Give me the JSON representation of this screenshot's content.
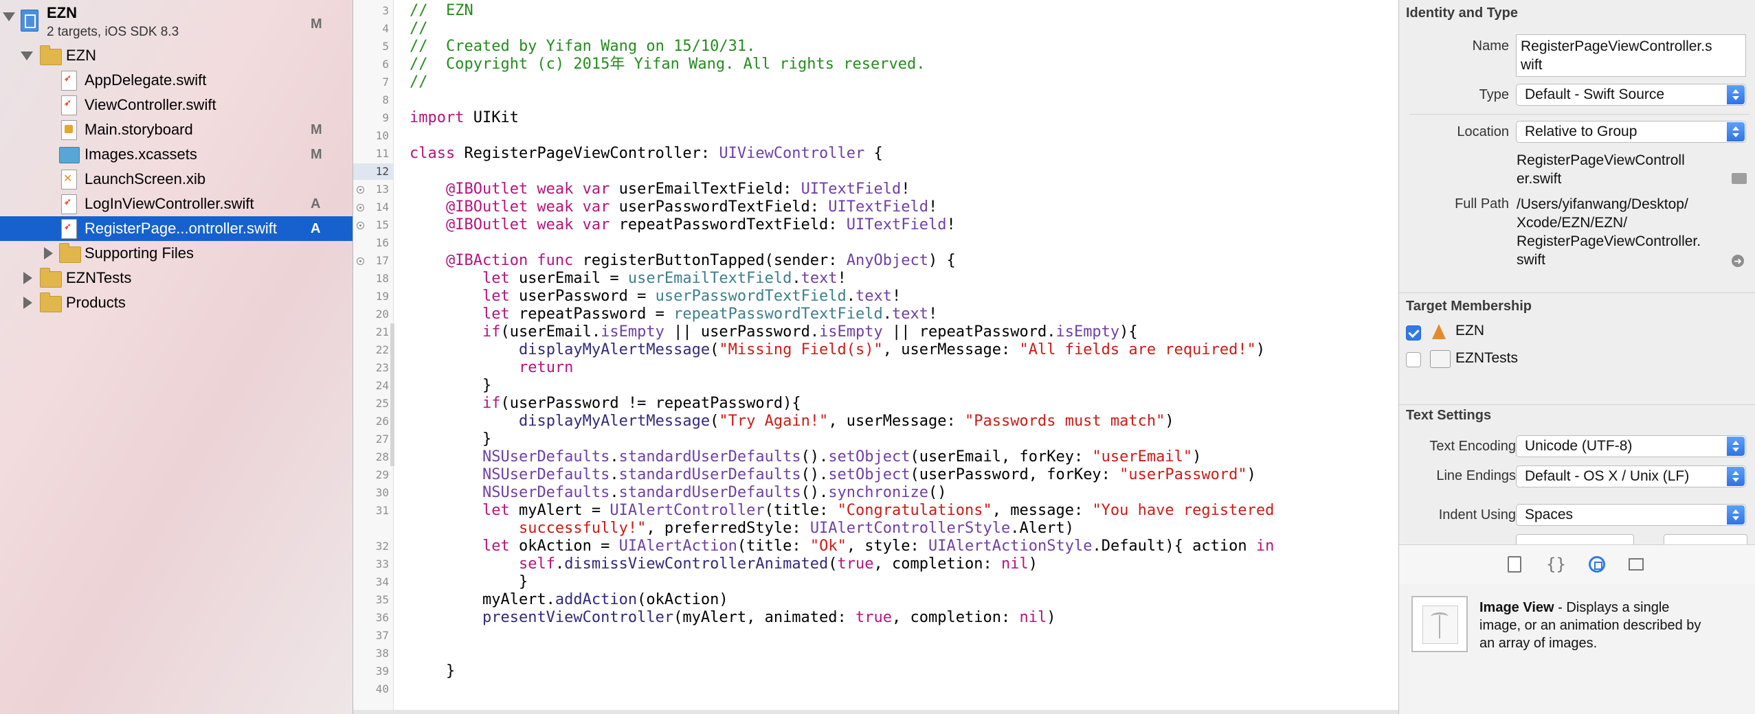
{
  "navigator": {
    "project": {
      "name": "EZN",
      "subtitle": "2 targets, iOS SDK 8.3",
      "badge": "M"
    },
    "items": [
      {
        "label": "EZN",
        "kind": "folder",
        "badge": "",
        "icon": "folder-icon"
      },
      {
        "label": "AppDelegate.swift",
        "kind": "swift",
        "badge": "",
        "icon": "swift-file-icon"
      },
      {
        "label": "ViewController.swift",
        "kind": "swift",
        "badge": "",
        "icon": "swift-file-icon"
      },
      {
        "label": "Main.storyboard",
        "kind": "storyboard",
        "badge": "M",
        "icon": "storyboard-file-icon"
      },
      {
        "label": "Images.xcassets",
        "kind": "assets",
        "badge": "M",
        "icon": "asset-catalog-icon"
      },
      {
        "label": "LaunchScreen.xib",
        "kind": "xib",
        "badge": "",
        "icon": "xib-file-icon"
      },
      {
        "label": "LogInViewController.swift",
        "kind": "swift",
        "badge": "A",
        "icon": "swift-file-icon"
      },
      {
        "label": "RegisterPage...ontroller.swift",
        "kind": "swift",
        "badge": "A",
        "icon": "swift-file-icon"
      },
      {
        "label": "Supporting Files",
        "kind": "folder",
        "badge": "",
        "icon": "folder-icon"
      },
      {
        "label": "EZNTests",
        "kind": "folder",
        "badge": "",
        "icon": "folder-icon"
      },
      {
        "label": "Products",
        "kind": "folder",
        "badge": "",
        "icon": "folder-icon"
      }
    ]
  },
  "editor": {
    "current_line": "12",
    "lines": [
      {
        "n": "3",
        "t": [
          [
            "c-com",
            "//  EZN"
          ]
        ]
      },
      {
        "n": "4",
        "t": [
          [
            "c-com",
            "//"
          ]
        ]
      },
      {
        "n": "5",
        "t": [
          [
            "c-com",
            "//  Created by Yifan Wang on 15/10/31."
          ]
        ]
      },
      {
        "n": "6",
        "t": [
          [
            "c-com",
            "//  Copyright (c) 2015年 Yifan Wang. All rights reserved."
          ]
        ]
      },
      {
        "n": "7",
        "t": [
          [
            "c-com",
            "//"
          ]
        ]
      },
      {
        "n": "8",
        "t": []
      },
      {
        "n": "9",
        "t": [
          [
            "c-kw",
            "import"
          ],
          [
            "",
            " UIKit"
          ]
        ]
      },
      {
        "n": "10",
        "t": []
      },
      {
        "n": "11",
        "t": [
          [
            "c-kw",
            "class"
          ],
          [
            "",
            " RegisterPageViewController: "
          ],
          [
            "c-typ",
            "UIViewController"
          ],
          [
            "",
            " {"
          ]
        ]
      },
      {
        "n": "12",
        "t": []
      },
      {
        "n": "13",
        "t": [
          [
            "",
            "    "
          ],
          [
            "c-kw",
            "@IBOutlet weak var"
          ],
          [
            "",
            " userEmailTextField: "
          ],
          [
            "c-typ",
            "UITextField"
          ],
          [
            "",
            "!"
          ]
        ]
      },
      {
        "n": "14",
        "t": [
          [
            "",
            "    "
          ],
          [
            "c-kw",
            "@IBOutlet weak var"
          ],
          [
            "",
            " userPasswordTextField: "
          ],
          [
            "c-typ",
            "UITextField"
          ],
          [
            "",
            "!"
          ]
        ]
      },
      {
        "n": "15",
        "t": [
          [
            "",
            "    "
          ],
          [
            "c-kw",
            "@IBOutlet weak var"
          ],
          [
            "",
            " repeatPasswordTextField: "
          ],
          [
            "c-typ",
            "UITextField"
          ],
          [
            "",
            "!"
          ]
        ]
      },
      {
        "n": "16",
        "t": []
      },
      {
        "n": "17",
        "t": [
          [
            "",
            "    "
          ],
          [
            "c-kw",
            "@IBAction func"
          ],
          [
            "",
            " registerButtonTapped(sender: "
          ],
          [
            "c-typ",
            "AnyObject"
          ],
          [
            "",
            ") {"
          ]
        ]
      },
      {
        "n": "18",
        "t": [
          [
            "",
            "        "
          ],
          [
            "c-kw",
            "let"
          ],
          [
            "",
            " userEmail = "
          ],
          [
            "c-pr",
            "userEmailTextField"
          ],
          [
            "",
            "."
          ],
          [
            "c-typ",
            "text"
          ],
          [
            "",
            "!"
          ]
        ]
      },
      {
        "n": "19",
        "t": [
          [
            "",
            "        "
          ],
          [
            "c-kw",
            "let"
          ],
          [
            "",
            " userPassword = "
          ],
          [
            "c-pr",
            "userPasswordTextField"
          ],
          [
            "",
            "."
          ],
          [
            "c-typ",
            "text"
          ],
          [
            "",
            "!"
          ]
        ]
      },
      {
        "n": "20",
        "t": [
          [
            "",
            "        "
          ],
          [
            "c-kw",
            "let"
          ],
          [
            "",
            " repeatPassword = "
          ],
          [
            "c-pr",
            "repeatPasswordTextField"
          ],
          [
            "",
            "."
          ],
          [
            "c-typ",
            "text"
          ],
          [
            "",
            "!"
          ]
        ]
      },
      {
        "n": "21",
        "t": [
          [
            "",
            "        "
          ],
          [
            "c-kw",
            "if"
          ],
          [
            "",
            "(userEmail."
          ],
          [
            "c-typ",
            "isEmpty"
          ],
          [
            "",
            " || userPassword."
          ],
          [
            "c-typ",
            "isEmpty"
          ],
          [
            "",
            " || repeatPassword."
          ],
          [
            "c-typ",
            "isEmpty"
          ],
          [
            "",
            "){"
          ]
        ]
      },
      {
        "n": "22",
        "t": [
          [
            "",
            "            "
          ],
          [
            "c-mt",
            "displayMyAlertMessage"
          ],
          [
            "",
            "("
          ],
          [
            "c-str",
            "\"Missing Field(s)\""
          ],
          [
            "",
            ", userMessage: "
          ],
          [
            "c-str",
            "\"All fields are required!\""
          ],
          [
            "",
            ")"
          ]
        ]
      },
      {
        "n": "23",
        "t": [
          [
            "",
            "            "
          ],
          [
            "c-kw",
            "return"
          ]
        ]
      },
      {
        "n": "24",
        "t": [
          [
            "",
            "        }"
          ]
        ]
      },
      {
        "n": "25",
        "t": [
          [
            "",
            "        "
          ],
          [
            "c-kw",
            "if"
          ],
          [
            "",
            "(userPassword != repeatPassword){"
          ]
        ]
      },
      {
        "n": "26",
        "t": [
          [
            "",
            "            "
          ],
          [
            "c-mt",
            "displayMyAlertMessage"
          ],
          [
            "",
            "("
          ],
          [
            "c-str",
            "\"Try Again!\""
          ],
          [
            "",
            ", userMessage: "
          ],
          [
            "c-str",
            "\"Passwords must match\""
          ],
          [
            "",
            ")"
          ]
        ]
      },
      {
        "n": "27",
        "t": [
          [
            "",
            "        }"
          ]
        ]
      },
      {
        "n": "28",
        "t": [
          [
            "",
            "        "
          ],
          [
            "c-typ",
            "NSUserDefaults"
          ],
          [
            "",
            "."
          ],
          [
            "c-typ",
            "standardUserDefaults"
          ],
          [
            "",
            "()."
          ],
          [
            "c-typ",
            "setObject"
          ],
          [
            "",
            "(userEmail, forKey: "
          ],
          [
            "c-str",
            "\"userEmail\""
          ],
          [
            "",
            ")"
          ]
        ]
      },
      {
        "n": "29",
        "t": [
          [
            "",
            "        "
          ],
          [
            "c-typ",
            "NSUserDefaults"
          ],
          [
            "",
            "."
          ],
          [
            "c-typ",
            "standardUserDefaults"
          ],
          [
            "",
            "()."
          ],
          [
            "c-typ",
            "setObject"
          ],
          [
            "",
            "(userPassword, forKey: "
          ],
          [
            "c-str",
            "\"userPassword\""
          ],
          [
            "",
            ")"
          ]
        ]
      },
      {
        "n": "30",
        "t": [
          [
            "",
            "        "
          ],
          [
            "c-typ",
            "NSUserDefaults"
          ],
          [
            "",
            "."
          ],
          [
            "c-typ",
            "standardUserDefaults"
          ],
          [
            "",
            "()."
          ],
          [
            "c-typ",
            "synchronize"
          ],
          [
            "",
            "()"
          ]
        ]
      },
      {
        "n": "31",
        "t": [
          [
            "",
            "        "
          ],
          [
            "c-kw",
            "let"
          ],
          [
            "",
            " myAlert = "
          ],
          [
            "c-typ",
            "UIAlertController"
          ],
          [
            "",
            "(title: "
          ],
          [
            "c-str",
            "\"Congratulations\""
          ],
          [
            "",
            ", message: "
          ],
          [
            "c-str",
            "\"You have registered"
          ]
        ]
      },
      {
        "n": "",
        "t": [
          [
            "",
            "            "
          ],
          [
            "c-str",
            "successfully!\""
          ],
          [
            "",
            ", preferredStyle: "
          ],
          [
            "c-typ",
            "UIAlertControllerStyle"
          ],
          [
            "",
            ".Alert)"
          ]
        ]
      },
      {
        "n": "32",
        "t": [
          [
            "",
            "        "
          ],
          [
            "c-kw",
            "let"
          ],
          [
            "",
            " okAction = "
          ],
          [
            "c-typ",
            "UIAlertAction"
          ],
          [
            "",
            "(title: "
          ],
          [
            "c-str",
            "\"Ok\""
          ],
          [
            "",
            ", style: "
          ],
          [
            "c-typ",
            "UIAlertActionStyle"
          ],
          [
            "",
            ".Default){ action "
          ],
          [
            "c-kw",
            "in"
          ]
        ]
      },
      {
        "n": "33",
        "t": [
          [
            "",
            "            "
          ],
          [
            "c-kw",
            "self"
          ],
          [
            "",
            "."
          ],
          [
            "c-mt",
            "dismissViewControllerAnimated"
          ],
          [
            "",
            "("
          ],
          [
            "c-kw",
            "true"
          ],
          [
            "",
            ", completion: "
          ],
          [
            "c-kw",
            "nil"
          ],
          [
            "",
            ")"
          ]
        ]
      },
      {
        "n": "34",
        "t": [
          [
            "",
            "            }"
          ]
        ]
      },
      {
        "n": "35",
        "t": [
          [
            "",
            "        myAlert."
          ],
          [
            "c-mt",
            "addAction"
          ],
          [
            "",
            "(okAction)"
          ]
        ]
      },
      {
        "n": "36",
        "t": [
          [
            "",
            "        "
          ],
          [
            "c-mt",
            "presentViewController"
          ],
          [
            "",
            "(myAlert, animated: "
          ],
          [
            "c-kw",
            "true"
          ],
          [
            "",
            ", completion: "
          ],
          [
            "c-kw",
            "nil"
          ],
          [
            "",
            ")"
          ]
        ]
      },
      {
        "n": "37",
        "t": []
      },
      {
        "n": "38",
        "t": []
      },
      {
        "n": "39",
        "t": [
          [
            "",
            "    }"
          ]
        ]
      },
      {
        "n": "40",
        "t": []
      }
    ]
  },
  "inspector": {
    "identity": {
      "title": "Identity and Type",
      "name_label": "Name",
      "name_value_1": "RegisterPageViewController.s",
      "name_value_2": "wift",
      "type_label": "Type",
      "type_value": "Default - Swift Source",
      "location_label": "Location",
      "location_value": "Relative to Group",
      "location_file_1": "RegisterPageViewControll",
      "location_file_2": "er.swift",
      "fullpath_label": "Full Path",
      "fullpath_1": "/Users/yifanwang/Desktop/",
      "fullpath_2": "Xcode/EZN/EZN/",
      "fullpath_3": "RegisterPageViewController.",
      "fullpath_4": "swift"
    },
    "target": {
      "title": "Target Membership",
      "items": [
        {
          "label": "EZN",
          "checked": true
        },
        {
          "label": "EZNTests",
          "checked": false
        }
      ]
    },
    "text_settings": {
      "title": "Text Settings",
      "encoding_label": "Text Encoding",
      "encoding_value": "Unicode (UTF-8)",
      "endings_label": "Line Endings",
      "endings_value": "Default - OS X / Unix (LF)",
      "indent_label": "Indent Using",
      "indent_value": "Spaces"
    },
    "library": {
      "title": "Image View",
      "sep": " - ",
      "line1": "Displays a single",
      "line2": "image, or an animation described by",
      "line3": "an array of images."
    },
    "accent": "#2f7ae6"
  }
}
